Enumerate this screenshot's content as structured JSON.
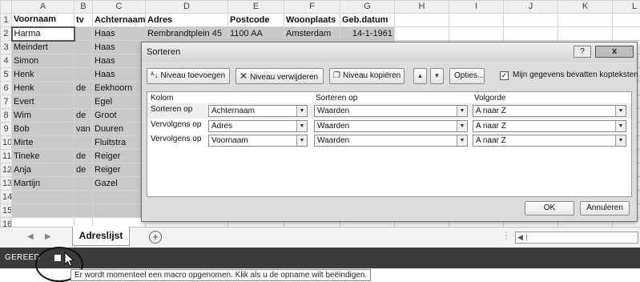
{
  "spreadsheet": {
    "columns": [
      "A",
      "B",
      "C",
      "D",
      "E",
      "F",
      "G",
      "H",
      "I",
      "J",
      "K",
      "L"
    ],
    "header_row": [
      "Voornaam",
      "tv",
      "Achternaam",
      "Adres",
      "Postcode",
      "Woonplaats",
      "Geb.datum"
    ],
    "row2": [
      "Harma",
      "",
      "Haas",
      "Rembrandtplein 45",
      "1100 AA",
      "Amsterdam",
      "14-1-1961"
    ],
    "first_names": [
      "Meindert",
      "Simon",
      "Henk",
      "Henk",
      "Evert",
      "Wim",
      "Bob",
      "Mirte",
      "Tineke",
      "Anja",
      "Martijn"
    ],
    "infixes": [
      "",
      "",
      "",
      "de",
      "",
      "de",
      "van",
      "",
      "de",
      "de",
      ""
    ],
    "last_names": [
      "Haas",
      "Haas",
      "Haas",
      "Eekhoorn",
      "Egel",
      "Groot",
      "Duuren",
      "Fluitstra",
      "Reiger",
      "Reiger",
      "Gazel"
    ],
    "row_numbers": [
      "1",
      "2",
      "3",
      "4",
      "5",
      "6",
      "7",
      "8",
      "9",
      "10",
      "11",
      "12",
      "13",
      "14",
      "15",
      "16"
    ]
  },
  "dialog": {
    "title": "Sorteren",
    "help": "?",
    "close": "x",
    "toolbar": {
      "add_level": "Niveau toevoegen",
      "delete_level": "Niveau verwijderen",
      "copy_level": "Niveau kopiëren",
      "options": "Opties...",
      "headers_checkbox": "Mijn gegevens bevatten kopteksten",
      "headers_checked": true
    },
    "column_headers": {
      "kolom": "Kolom",
      "sort_on": "Sorteren op",
      "order": "Volgorde"
    },
    "levels": [
      {
        "label": "Sorteren op",
        "column": "Achternaam",
        "sort_on": "Waarden",
        "order": "A naar Z"
      },
      {
        "label": "Vervolgens op",
        "column": "Adres",
        "sort_on": "Waarden",
        "order": "A naar Z"
      },
      {
        "label": "Vervolgens op",
        "column": "Voornaam",
        "sort_on": "Waarden",
        "order": "A naar Z"
      }
    ],
    "ok": "OK",
    "cancel": "Annuleren"
  },
  "sheet_tab": "Adreslijst",
  "add_sheet": "+",
  "statusbar": {
    "status": "GEREED",
    "tooltip": "Er wordt momenteel een macro opgenomen. Klik als u de opname wilt beëindigen."
  }
}
